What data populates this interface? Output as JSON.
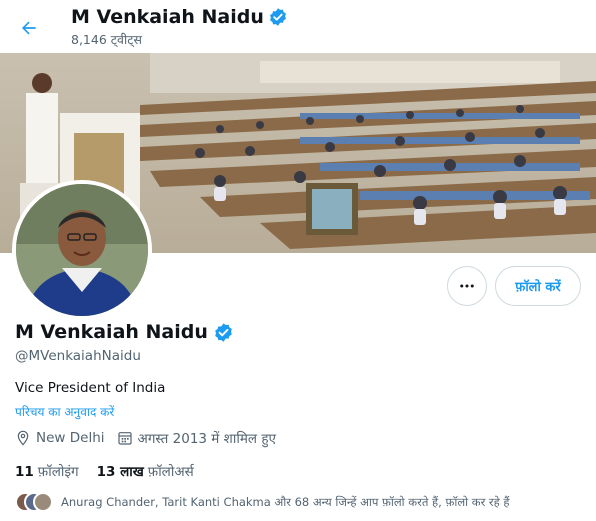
{
  "header": {
    "name": "M Venkaiah Naidu",
    "tweet_count": "8,146 ट्वीट्स"
  },
  "profile": {
    "name": "M Venkaiah Naidu",
    "handle": "@MVenkaiahNaidu",
    "bio": "Vice President of India",
    "translate_link": "परिचय का अनुवाद करें",
    "location": "New Delhi",
    "joined": "अगस्त 2013 में शामिल हुए",
    "following_count": "11",
    "following_label": "फ़ॉलोइंग",
    "followers_count": "13 लाख",
    "followers_label": "फ़ॉलोअर्स",
    "followed_by": "Anurag Chander, Tarit Kanti Chakma और 68 अन्य जिन्हें आप फ़ॉलो करते हैं, फ़ॉलो कर रहे हैं"
  },
  "actions": {
    "follow_label": "फ़ॉलो करें"
  },
  "colors": {
    "accent": "#1d9bf0",
    "verified": "#1d9bf0",
    "muted_text": "#536471"
  },
  "icons": [
    "back-arrow-icon",
    "verified-badge-icon",
    "more-icon",
    "location-icon",
    "calendar-icon"
  ]
}
